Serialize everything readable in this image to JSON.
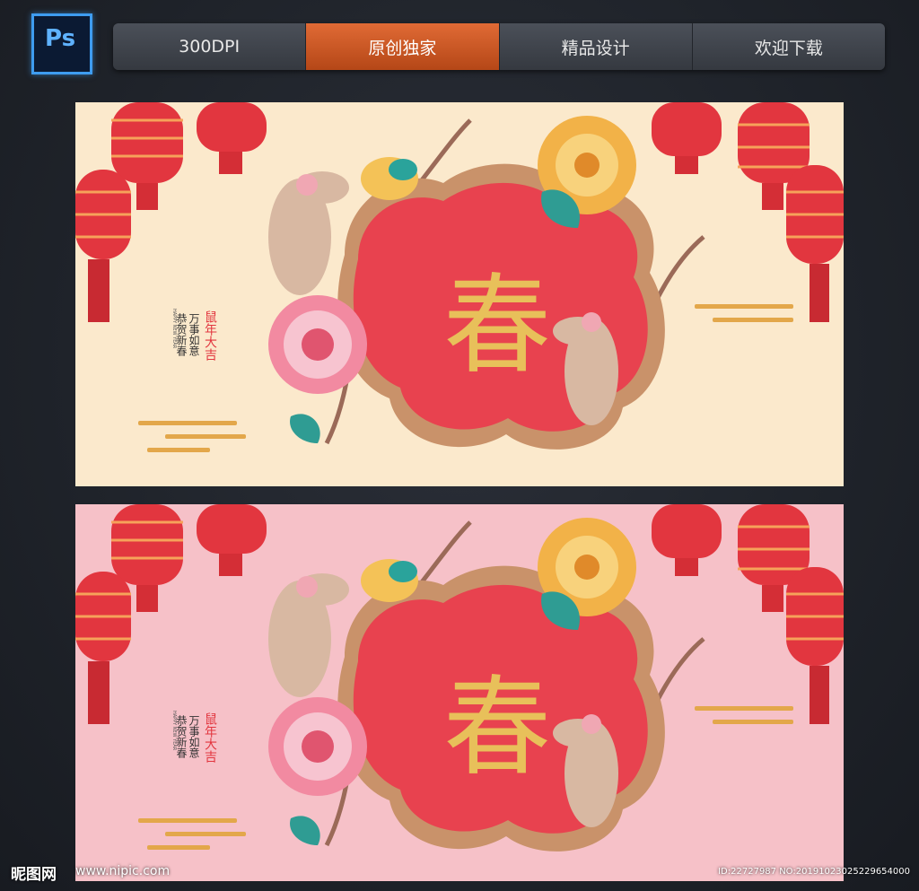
{
  "app": {
    "logo_text": "Ps"
  },
  "tabs": [
    {
      "label": "300DPI",
      "active": false
    },
    {
      "label": "原创独家",
      "active": true
    },
    {
      "label": "精品设计",
      "active": false
    },
    {
      "label": "欢迎下载",
      "active": false
    }
  ],
  "posters": [
    {
      "variant": "cream",
      "background": "#fbe9cc",
      "main_character": "春",
      "seal_text": "鼠年大吉",
      "greeting_line1": "恭贺新春",
      "greeting_line2": "万事如意",
      "english_text": "HAPPY NEW YEAR"
    },
    {
      "variant": "pink",
      "background": "#f6c1c8",
      "main_character": "春",
      "seal_text": "鼠年大吉",
      "greeting_line1": "恭贺新春",
      "greeting_line2": "万事如意",
      "english_text": "HAPPY NEW YEAR"
    }
  ],
  "watermark": {
    "site_name": "昵图网",
    "url": "www.nipic.com",
    "id_text": "ID:22727987 NO:20191023025229654000"
  },
  "colors": {
    "accent_tab": "#d2572a",
    "lantern_red": "#e2363f",
    "frame_red": "#e8424f",
    "gold": "#e0b14a"
  }
}
